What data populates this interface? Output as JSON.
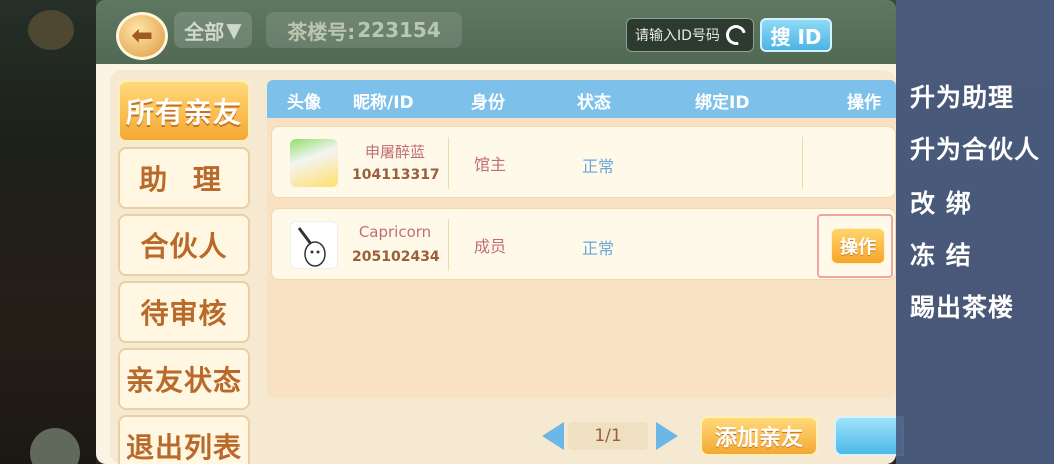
{
  "header": {
    "filter_label": "全部",
    "room_label": "茶楼号:",
    "room_number": "223154",
    "search_placeholder": "请输入ID号码",
    "search_button": "搜 ID"
  },
  "nav": {
    "items": [
      {
        "label": "所有亲友",
        "active": true
      },
      {
        "label": "助 理",
        "active": false
      },
      {
        "label": "合伙人",
        "active": false
      },
      {
        "label": "待审核",
        "active": false
      },
      {
        "label": "亲友状态",
        "active": false
      },
      {
        "label": "退出列表",
        "active": false
      }
    ]
  },
  "table": {
    "headers": {
      "avatar": "头像",
      "name_id": "昵称/ID",
      "role": "身份",
      "status": "状态",
      "bound_id": "绑定ID",
      "action": "操作"
    },
    "rows": [
      {
        "name": "申屠醉蓝",
        "id": "104113317",
        "role": "馆主",
        "status": "正常",
        "bound_id": "",
        "action": ""
      },
      {
        "name": "Capricorn",
        "id": "205102434",
        "role": "成员",
        "status": "正常",
        "bound_id": "",
        "action": "操作"
      }
    ]
  },
  "pagination": {
    "page": "1/1"
  },
  "footer": {
    "add_friend": "添加亲友"
  },
  "context_menu": {
    "items": [
      "升为助理",
      "升为合伙人",
      "改 绑",
      "冻 结",
      "踢出茶楼"
    ]
  },
  "colors": {
    "accent_orange": "#f5a832",
    "header_blue": "#7dc0ea",
    "menu_bg": "#4b5c80"
  }
}
